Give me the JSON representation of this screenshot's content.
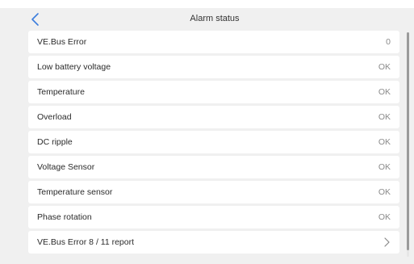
{
  "header": {
    "title": "Alarm status"
  },
  "rows": [
    {
      "label": "VE.Bus Error",
      "value": "0"
    },
    {
      "label": "Low battery voltage",
      "value": "OK"
    },
    {
      "label": "Temperature",
      "value": "OK"
    },
    {
      "label": "Overload",
      "value": "OK"
    },
    {
      "label": "DC ripple",
      "value": "OK"
    },
    {
      "label": "Voltage Sensor",
      "value": "OK"
    },
    {
      "label": "Temperature sensor",
      "value": "OK"
    },
    {
      "label": "Phase rotation",
      "value": "OK"
    }
  ],
  "link_row": {
    "label": "VE.Bus Error 8 / 11 report"
  },
  "colors": {
    "accent": "#3b7ddd",
    "background": "#f0f0f0",
    "row": "#ffffff"
  },
  "icons": {
    "back": "chevron-left-icon",
    "forward": "chevron-right-icon"
  }
}
